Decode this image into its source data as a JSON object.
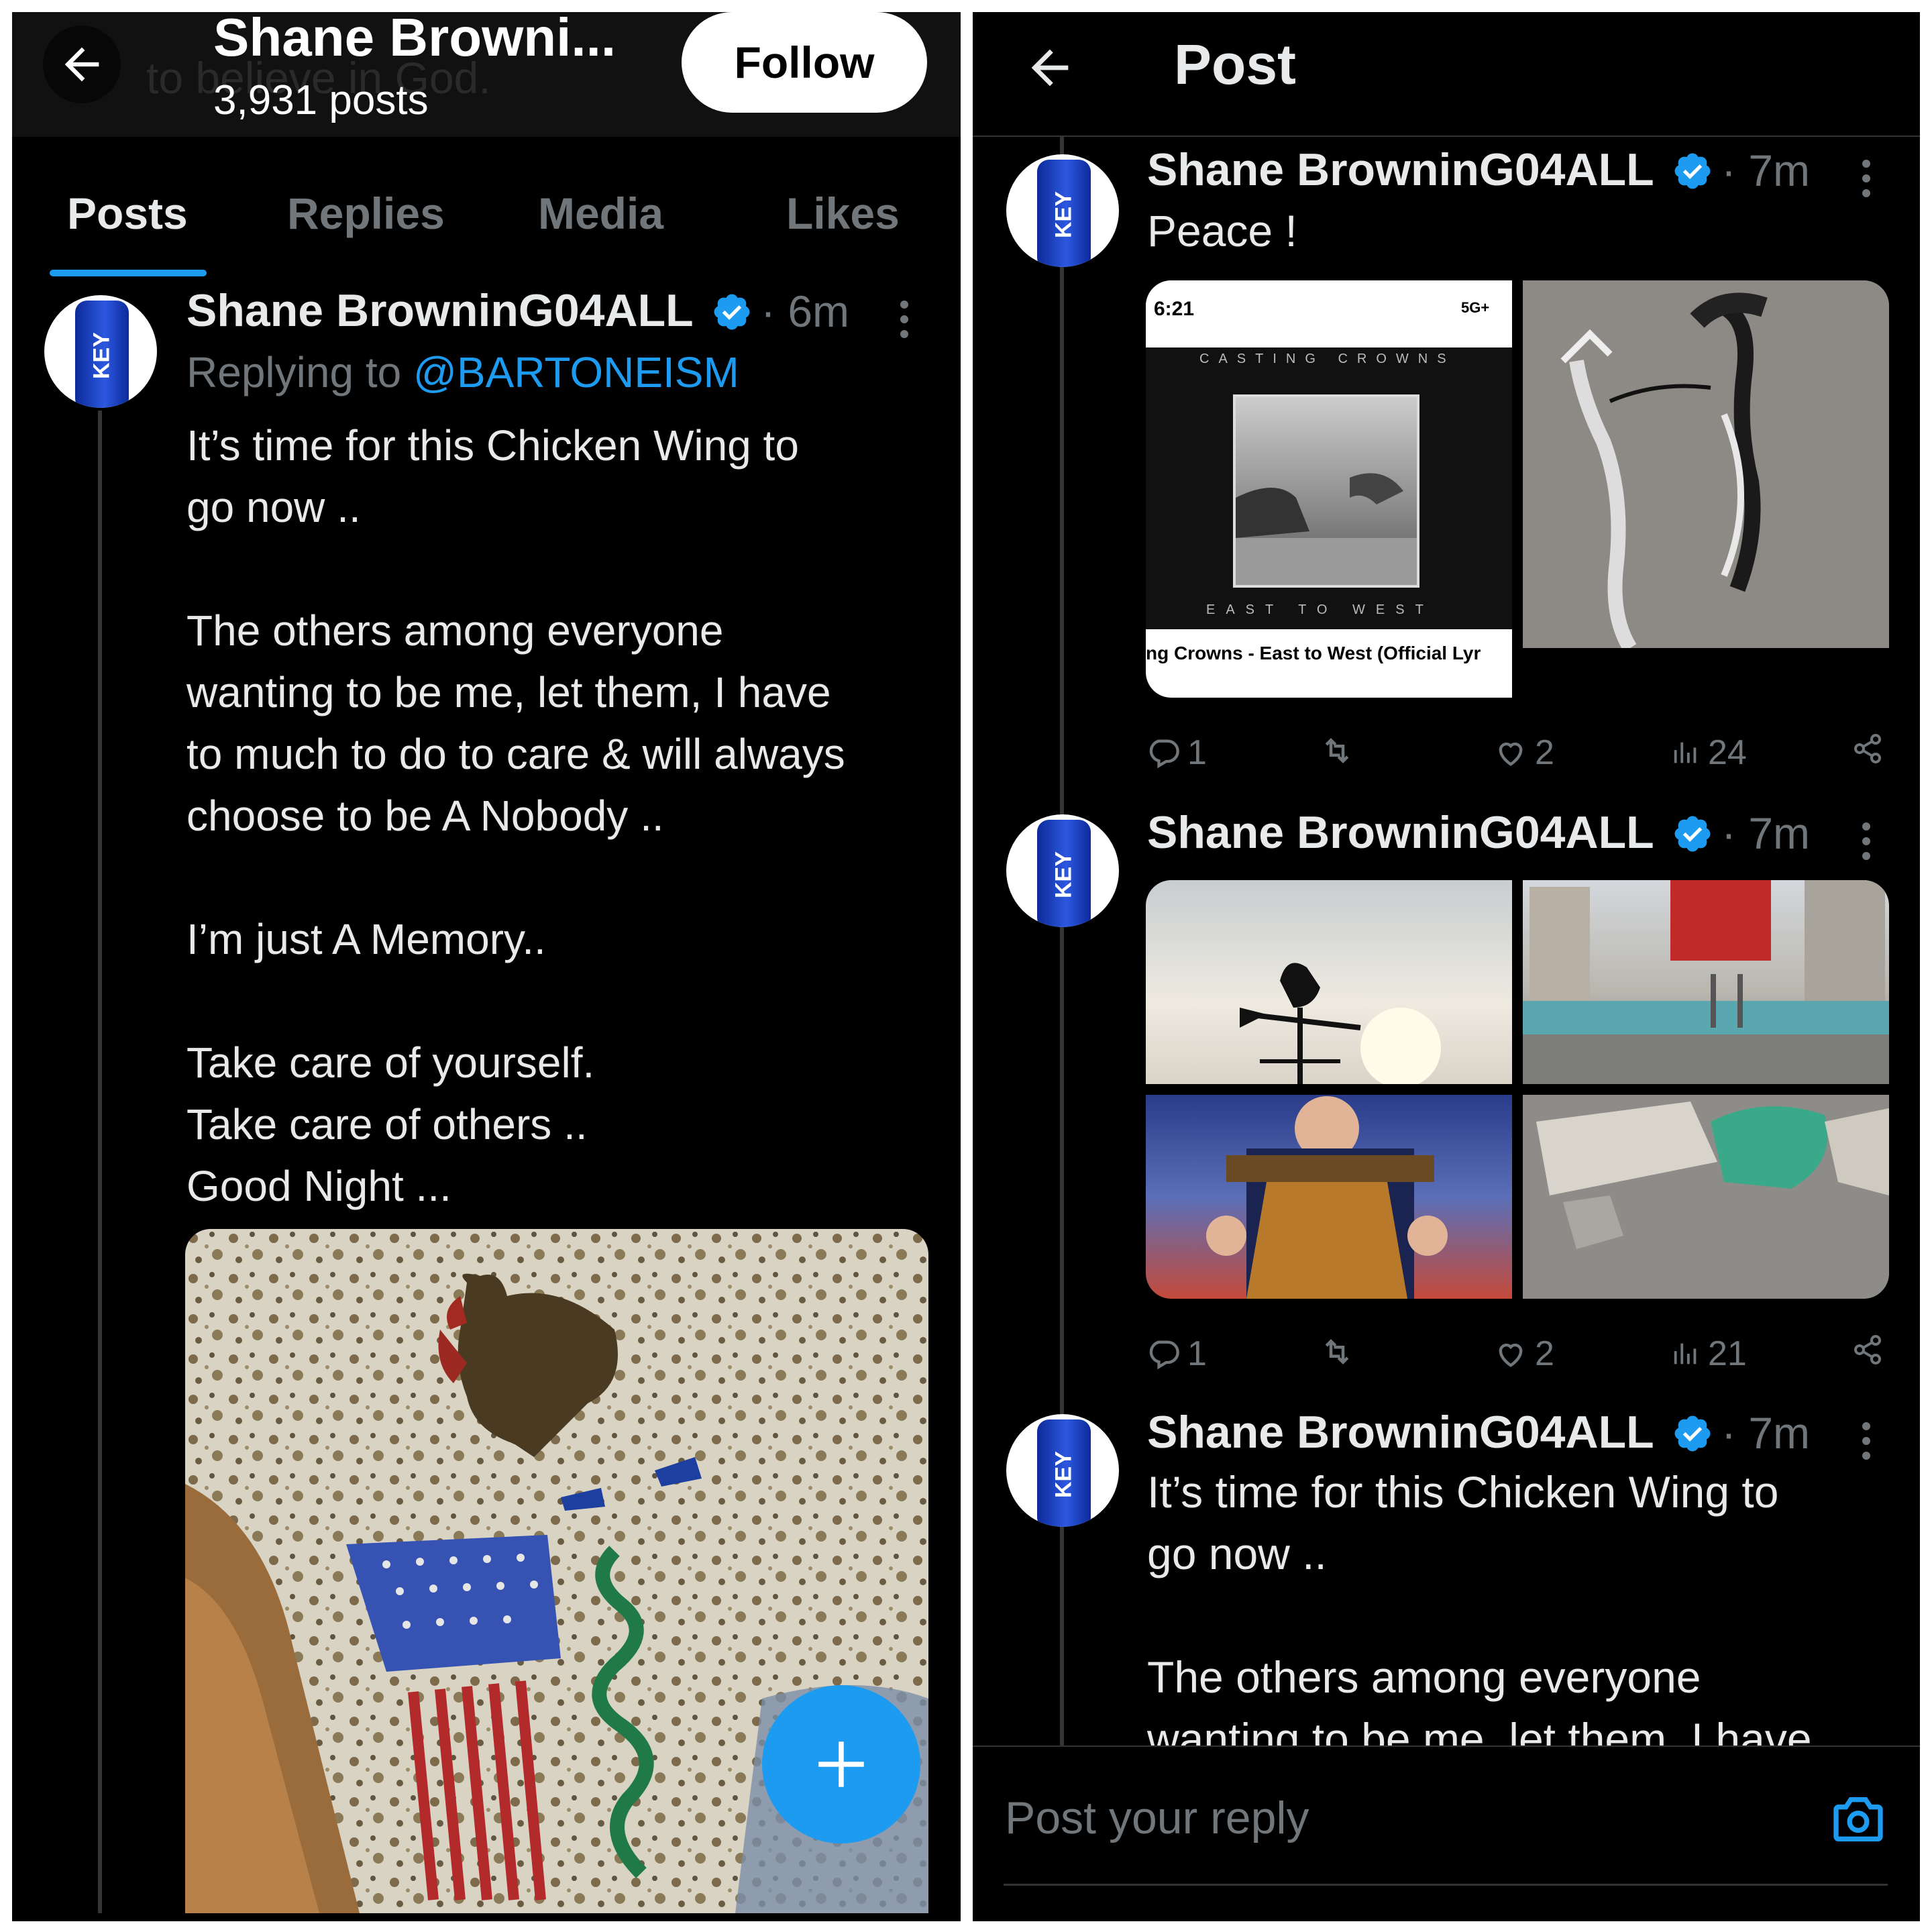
{
  "left": {
    "header": {
      "title": "Shane Browni...",
      "posts_count": "3,931 posts",
      "follow_label": "Follow",
      "banner_text": "to believe in God."
    },
    "tabs": [
      {
        "label": "Posts",
        "active": true
      },
      {
        "label": "Replies",
        "active": false
      },
      {
        "label": "Media",
        "active": false
      },
      {
        "label": "Likes",
        "active": false
      }
    ],
    "post": {
      "author": "Shane BrowninG04ALL",
      "time": "· 6m",
      "replying_prefix": "Replying to",
      "replying_handle": "@BARTONEISM",
      "text": "It’s time for this Chicken Wing to\ngo now ..\n\nThe others among everyone\nwanting to be me, let them, I have\nto much to do to care & will always\nchoose to be A Nobody ..\n\nI’m just A Memory..\n\nTake care of yourself.\nTake care of others ..\nGood Night ..."
    }
  },
  "right": {
    "header": {
      "title": "Post"
    },
    "posts": [
      {
        "author": "Shane BrowninG04ALL",
        "time": "· 7m",
        "text": "Peace !",
        "screenshot_status_time": "6:21",
        "screenshot_status_net": "5G+",
        "album_top": "CASTING CROWNS",
        "album_bottom": "EAST TO WEST",
        "album_caption": "ng Crowns - East to West (Official Lyr",
        "stats": {
          "replies": "1",
          "likes": "2",
          "views": "24"
        }
      },
      {
        "author": "Shane BrowninG04ALL",
        "time": "· 7m",
        "stats": {
          "replies": "1",
          "likes": "2",
          "views": "21"
        }
      },
      {
        "author": "Shane BrowninG04ALL",
        "time": "· 7m",
        "text": "It’s time for this Chicken Wing to\ngo now ..\n\nThe others among everyone\nwanting to be me, let them, I have"
      }
    ],
    "reply_placeholder": "Post your reply"
  },
  "colors": {
    "accent": "#1d9bf0",
    "background": "#000000",
    "muted": "#71767b",
    "text": "#e7e9ea"
  },
  "icons": [
    "back-arrow-icon",
    "verified-icon",
    "more-icon",
    "reply-icon",
    "repost-icon",
    "like-icon",
    "views-icon",
    "share-icon",
    "compose-icon",
    "camera-icon"
  ]
}
